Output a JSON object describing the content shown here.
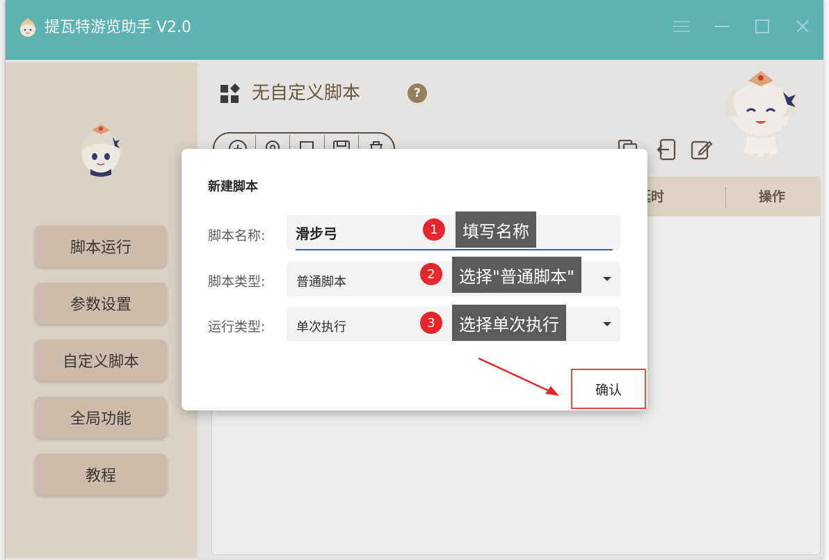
{
  "app": {
    "title": "提瓦特游览助手 V2.0"
  },
  "sidebar": {
    "items": [
      {
        "label": "脚本运行"
      },
      {
        "label": "参数设置"
      },
      {
        "label": "自定义脚本"
      },
      {
        "label": "全局功能"
      },
      {
        "label": "教程"
      }
    ]
  },
  "main": {
    "page_title": "无自定义脚本",
    "help_glyph": "?",
    "table_headers": [
      "延时",
      "操作"
    ]
  },
  "dialog": {
    "title": "新建脚本",
    "fields": {
      "name": {
        "label": "脚本名称:",
        "value": "滑步弓"
      },
      "type": {
        "label": "脚本类型:",
        "value": "普通脚本"
      },
      "run_type": {
        "label": "运行类型:",
        "value": "单次执行"
      }
    },
    "confirm_label": "确认"
  },
  "annotations": [
    {
      "number": "1",
      "text": "填写名称"
    },
    {
      "number": "2",
      "text": "选择\"普通脚本\""
    },
    {
      "number": "3",
      "text": "选择单次执行"
    }
  ],
  "colors": {
    "titlebar": "#5fb9b5",
    "sidebar": "#e2d9cc",
    "nav_button": "#d2c3b1",
    "annotation_red": "#e8252c",
    "callout": "#5b5b5b"
  }
}
